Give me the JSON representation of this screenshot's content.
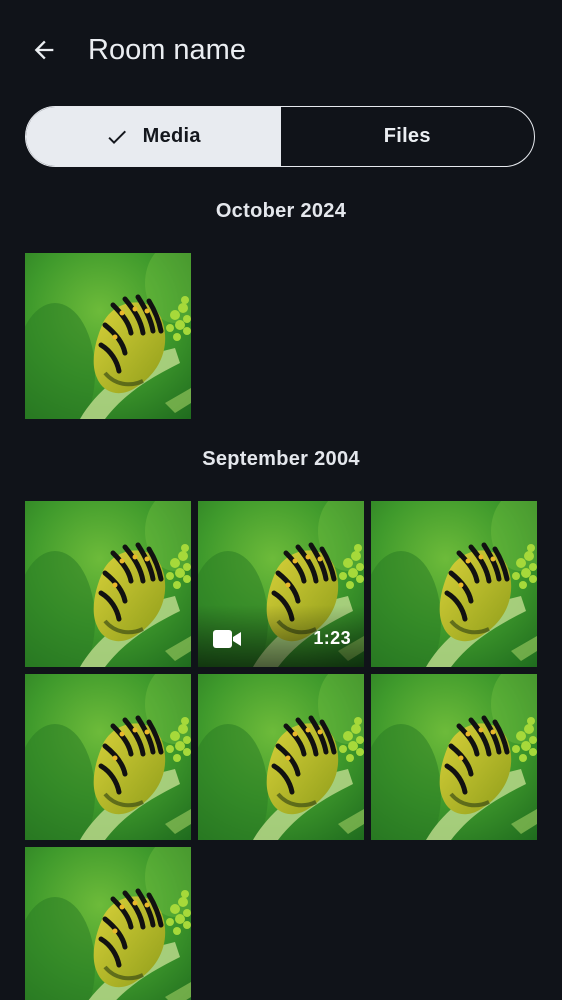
{
  "header": {
    "title": "Room name",
    "back_icon": "arrow-left-icon"
  },
  "tabs": {
    "media_label": "Media",
    "files_label": "Files",
    "selected": "media",
    "check_icon": "check-icon"
  },
  "sections": [
    {
      "label": "October 2024",
      "items": [
        {
          "type": "image"
        }
      ]
    },
    {
      "label": "September 2004",
      "items": [
        {
          "type": "image"
        },
        {
          "type": "video",
          "duration": "1:23",
          "icon": "video-camera-icon"
        },
        {
          "type": "image"
        },
        {
          "type": "image"
        },
        {
          "type": "image"
        },
        {
          "type": "image"
        },
        {
          "type": "image"
        }
      ]
    }
  ],
  "colors": {
    "background": "#101319",
    "selected_tab_bg": "#e8ebf0",
    "text": "#ebeef2"
  }
}
